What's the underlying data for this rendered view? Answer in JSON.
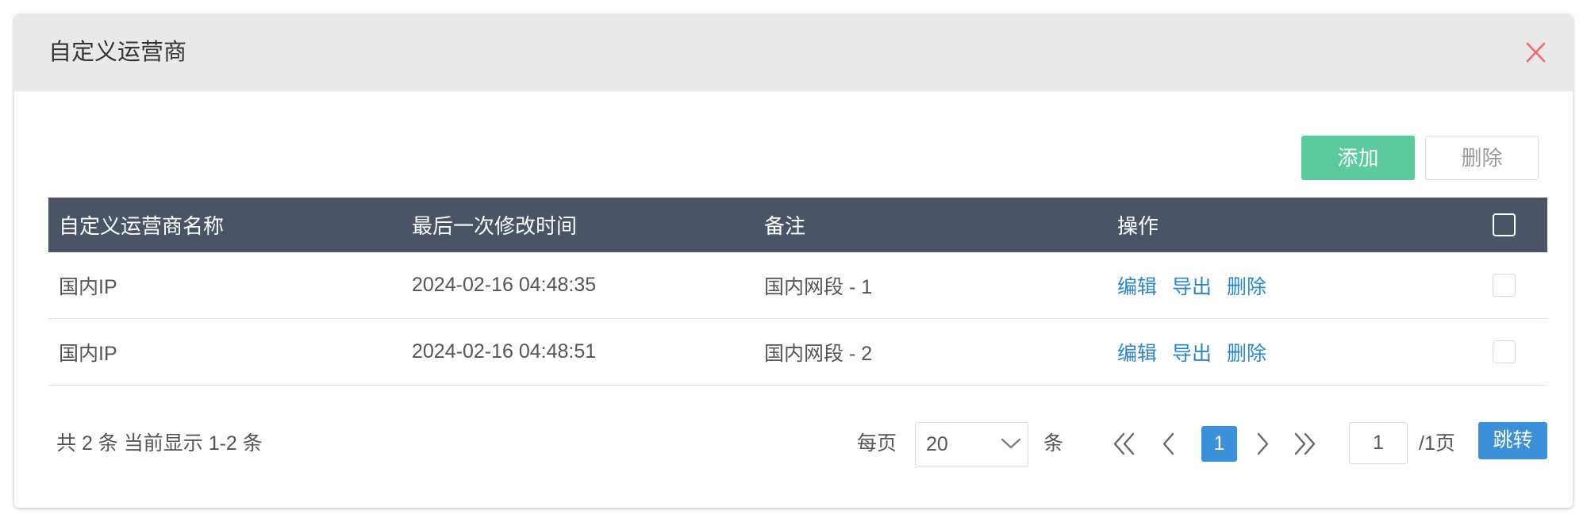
{
  "dialog": {
    "title": "自定义运营商"
  },
  "toolbar": {
    "add_label": "添加",
    "delete_label": "删除"
  },
  "table": {
    "columns": [
      "自定义运营商名称",
      "最后一次修改时间",
      "备注",
      "操作"
    ],
    "select_all": false,
    "rows": [
      {
        "name": "国内IP",
        "modified": "2024-02-16 04:48:35",
        "remark": "国内网段 - 1",
        "actions": [
          "编辑",
          "导出",
          "删除"
        ],
        "selected": false
      },
      {
        "name": "国内IP",
        "modified": "2024-02-16 04:48:51",
        "remark": "国内网段 - 2",
        "actions": [
          "编辑",
          "导出",
          "删除"
        ],
        "selected": false
      }
    ]
  },
  "pagination": {
    "summary": "共 2 条 当前显示 1-2 条",
    "per_page_label": "每页",
    "per_page_value": "20",
    "per_page_unit": "条",
    "current_page": "1",
    "jump_value": "1",
    "total_pages_label": "/1页",
    "jump_label": "跳转"
  },
  "icons": {
    "close": "close-icon",
    "select_chevron": "chevron-down-icon",
    "first_page": "double-chevron-left-icon",
    "prev_page": "chevron-left-icon",
    "next_page": "chevron-right-icon",
    "last_page": "double-chevron-right-icon"
  },
  "colors": {
    "add_button": "#5bcb9f",
    "primary": "#3c8fd9",
    "link": "#2a86c8",
    "table_header": "#4b5467",
    "close_icon": "#ef6b6b",
    "dialog_header": "#e9e9e9"
  }
}
